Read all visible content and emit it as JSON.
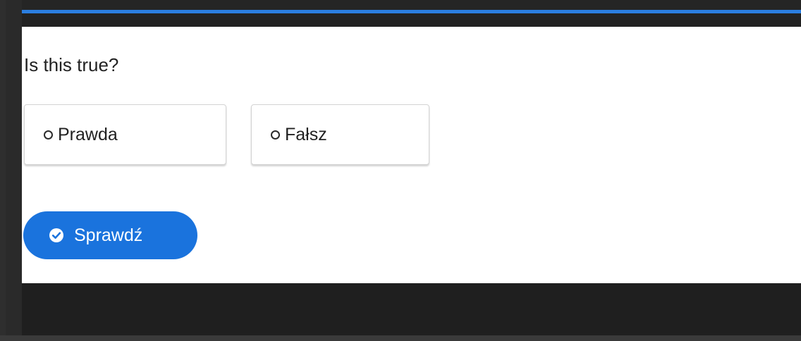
{
  "question": {
    "text": "Is this true?"
  },
  "options": [
    {
      "label": "Prawda"
    },
    {
      "label": "Fałsz"
    }
  ],
  "check_button": {
    "label": "Sprawdź",
    "icon": "check-circle-icon"
  },
  "colors": {
    "accent": "#2b7ee0",
    "button": "#1a73dd"
  }
}
